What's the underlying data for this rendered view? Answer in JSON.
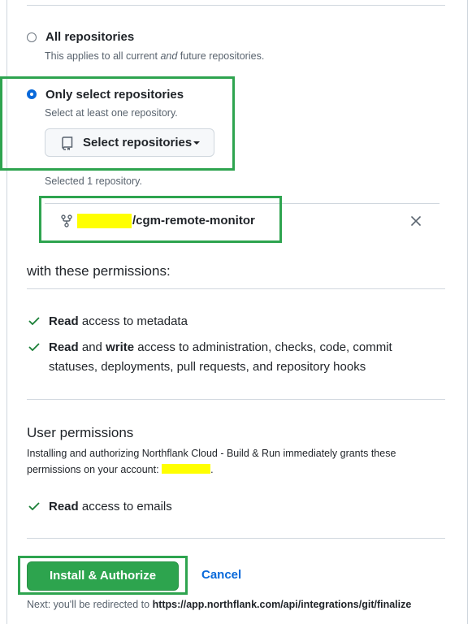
{
  "repository_access": {
    "all": {
      "label": "All repositories",
      "desc_before": "This applies to all current ",
      "desc_em": "and",
      "desc_after": " future repositories.",
      "checked": false
    },
    "select": {
      "label": "Only select repositories",
      "desc": "Select at least one repository.",
      "checked": true
    },
    "select_button_label": "Select repositories",
    "selected_count_text": "Selected 1 repository.",
    "selected_repos": [
      {
        "owner_redacted": true,
        "name": "/cgm-remote-monitor"
      }
    ]
  },
  "permissions": {
    "title": "with these permissions:",
    "items": [
      {
        "strong1": "Read",
        "text1": " access to metadata"
      },
      {
        "strong1": "Read",
        "text1": " and ",
        "strong2": "write",
        "text2": " access to administration, checks, code, commit statuses, deployments, pull requests, and repository hooks"
      }
    ]
  },
  "user_permissions": {
    "title": "User permissions",
    "desc": "Installing and authorizing Northflank Cloud - Build & Run immediately grants these permissions on your account:",
    "desc_end": ".",
    "items": [
      {
        "strong1": "Read",
        "text1": " access to emails"
      }
    ]
  },
  "actions": {
    "install_label": "Install & Authorize",
    "cancel_label": "Cancel",
    "next_prefix": "Next: you'll be redirected to ",
    "next_url": "https://app.northflank.com/api/integrations/git/finalize"
  },
  "colors": {
    "accent_blue": "#0969da",
    "primary_green": "#2da44e",
    "annotation_green": "#2ea44f",
    "redaction_yellow": "#ffff00"
  },
  "icons": {
    "repo": "repo-icon",
    "fork": "repo-forked-icon",
    "remove": "x-icon",
    "check": "check-icon"
  }
}
